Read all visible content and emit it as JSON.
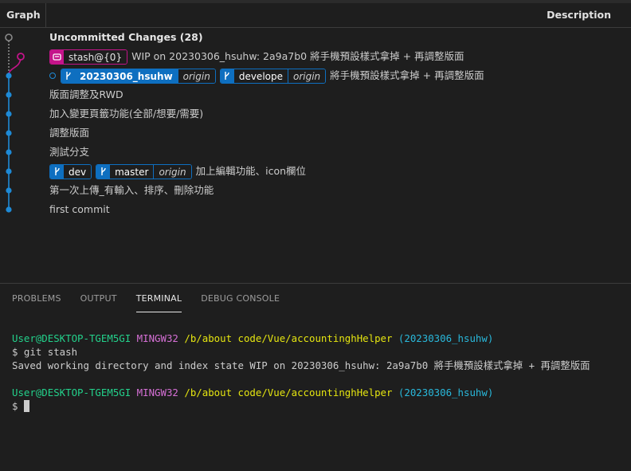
{
  "graph_header": {
    "graph_label": "Graph",
    "description_label": "Description"
  },
  "commits": [
    {
      "message": "Uncommitted Changes (28)",
      "refs": []
    },
    {
      "message": "WIP on 20230306_hsuhw: 2a9a7b0 將手機預設樣式拿掉 + 再調整版面",
      "refs": [
        {
          "name": "stash@{0}",
          "type": "stash",
          "icon": "stash-icon"
        }
      ]
    },
    {
      "message": "將手機預設樣式拿掉 + 再調整版面",
      "refs": [
        {
          "name": "20230306_hsuhw",
          "type": "branch-head",
          "remote": "origin",
          "icon": "branch-icon"
        },
        {
          "name": "develope",
          "type": "branch",
          "remote": "origin",
          "icon": "branch-icon"
        }
      ]
    },
    {
      "message": "版面調整及RWD",
      "refs": []
    },
    {
      "message": "加入變更頁籤功能(全部/想要/需要)",
      "refs": []
    },
    {
      "message": "調整版面",
      "refs": []
    },
    {
      "message": "測試分支",
      "refs": []
    },
    {
      "message": "加上編輯功能、icon欄位",
      "refs": [
        {
          "name": "dev",
          "type": "branch",
          "icon": "branch-icon"
        },
        {
          "name": "master",
          "type": "branch",
          "remote": "origin",
          "icon": "branch-icon"
        }
      ]
    },
    {
      "message": "第一次上傳_有輸入、排序、刪除功能",
      "refs": []
    },
    {
      "message": "first commit",
      "refs": []
    }
  ],
  "panel": {
    "tabs": [
      {
        "label": "PROBLEMS",
        "active": false
      },
      {
        "label": "OUTPUT",
        "active": false
      },
      {
        "label": "TERMINAL",
        "active": true
      },
      {
        "label": "DEBUG CONSOLE",
        "active": false
      }
    ]
  },
  "terminal": {
    "prompt1": {
      "user": "User@DESKTOP-TGEM5GI",
      "env": "MINGW32",
      "path": "/b/about code/Vue/accountinghHelper",
      "branch": "(20230306_hsuhw)"
    },
    "command": "$ git stash",
    "output": "Saved working directory and index state WIP on 20230306_hsuhw: 2a9a7b0 將手機預設樣式拿掉 + 再調整版面",
    "prompt2": {
      "user": "User@DESKTOP-TGEM5GI",
      "env": "MINGW32",
      "path": "/b/about code/Vue/accountinghHelper",
      "branch": "(20230306_hsuhw)"
    },
    "input_prompt": "$"
  },
  "colors": {
    "background": "#1e1e1e",
    "branch_blue": "#0e6fc0",
    "graph_line_blue": "#1e8ad6",
    "stash_pink": "#c4148a",
    "uncommitted_gray": "#8a8a8a",
    "term_user_green": "#23d18b",
    "term_env_magenta": "#d670d6",
    "term_path_yellow": "#e5e510",
    "term_branch_cyan": "#29b8db"
  }
}
